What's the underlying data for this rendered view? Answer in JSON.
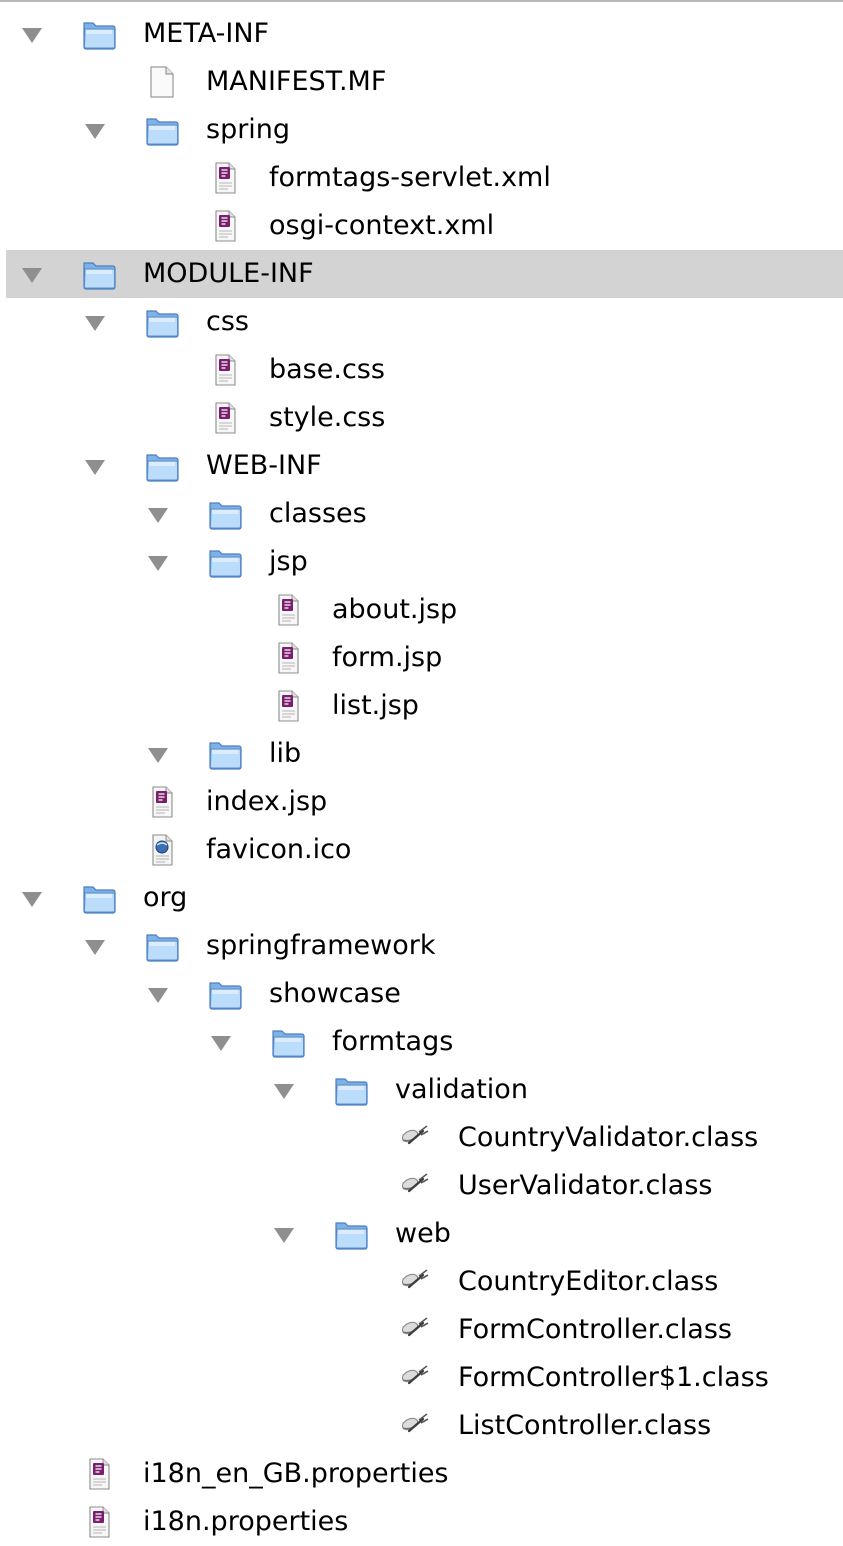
{
  "tree": [
    {
      "label": "META-INF",
      "kind": "folder",
      "depth": 0,
      "expanded": true
    },
    {
      "label": "MANIFEST.MF",
      "kind": "blank-file",
      "depth": 1
    },
    {
      "label": "spring",
      "kind": "folder",
      "depth": 1,
      "expanded": true
    },
    {
      "label": "formtags-servlet.xml",
      "kind": "doc-file",
      "depth": 2
    },
    {
      "label": "osgi-context.xml",
      "kind": "doc-file",
      "depth": 2
    },
    {
      "label": "MODULE-INF",
      "kind": "folder",
      "depth": 0,
      "expanded": true,
      "selected": true
    },
    {
      "label": "css",
      "kind": "folder",
      "depth": 1,
      "expanded": true
    },
    {
      "label": "base.css",
      "kind": "doc-file",
      "depth": 2
    },
    {
      "label": "style.css",
      "kind": "doc-file",
      "depth": 2
    },
    {
      "label": "WEB-INF",
      "kind": "folder",
      "depth": 1,
      "expanded": true
    },
    {
      "label": "classes",
      "kind": "folder",
      "depth": 2,
      "expanded": true
    },
    {
      "label": "jsp",
      "kind": "folder",
      "depth": 2,
      "expanded": true
    },
    {
      "label": "about.jsp",
      "kind": "doc-file",
      "depth": 3
    },
    {
      "label": "form.jsp",
      "kind": "doc-file",
      "depth": 3
    },
    {
      "label": "list.jsp",
      "kind": "doc-file",
      "depth": 3
    },
    {
      "label": "lib",
      "kind": "folder",
      "depth": 2,
      "expanded": true
    },
    {
      "label": "index.jsp",
      "kind": "doc-file",
      "depth": 1
    },
    {
      "label": "favicon.ico",
      "kind": "image-file",
      "depth": 1
    },
    {
      "label": "org",
      "kind": "folder",
      "depth": 0,
      "expanded": true
    },
    {
      "label": "springframework",
      "kind": "folder",
      "depth": 1,
      "expanded": true
    },
    {
      "label": "showcase",
      "kind": "folder",
      "depth": 2,
      "expanded": true
    },
    {
      "label": "formtags",
      "kind": "folder",
      "depth": 3,
      "expanded": true
    },
    {
      "label": "validation",
      "kind": "folder",
      "depth": 4,
      "expanded": true
    },
    {
      "label": "CountryValidator.class",
      "kind": "class-file",
      "depth": 5
    },
    {
      "label": "UserValidator.class",
      "kind": "class-file",
      "depth": 5
    },
    {
      "label": "web",
      "kind": "folder",
      "depth": 4,
      "expanded": true
    },
    {
      "label": "CountryEditor.class",
      "kind": "class-file",
      "depth": 5
    },
    {
      "label": "FormController.class",
      "kind": "class-file",
      "depth": 5
    },
    {
      "label": "FormController$1.class",
      "kind": "class-file",
      "depth": 5
    },
    {
      "label": "ListController.class",
      "kind": "class-file",
      "depth": 5
    },
    {
      "label": "i18n_en_GB.properties",
      "kind": "doc-file",
      "depth": 0
    },
    {
      "label": "i18n.properties",
      "kind": "doc-file",
      "depth": 0
    }
  ],
  "icons": {
    "folder": "folder-icon",
    "blank-file": "blank-document-icon",
    "doc-file": "text-document-icon",
    "image-file": "image-document-icon",
    "class-file": "java-class-file-icon"
  },
  "colors": {
    "selected_row": "#d3d3d3",
    "disclosure_triangle": "#8f8f8f",
    "folder_fill": "#a9cdf4",
    "doc_badge": "#7a1f6e"
  }
}
